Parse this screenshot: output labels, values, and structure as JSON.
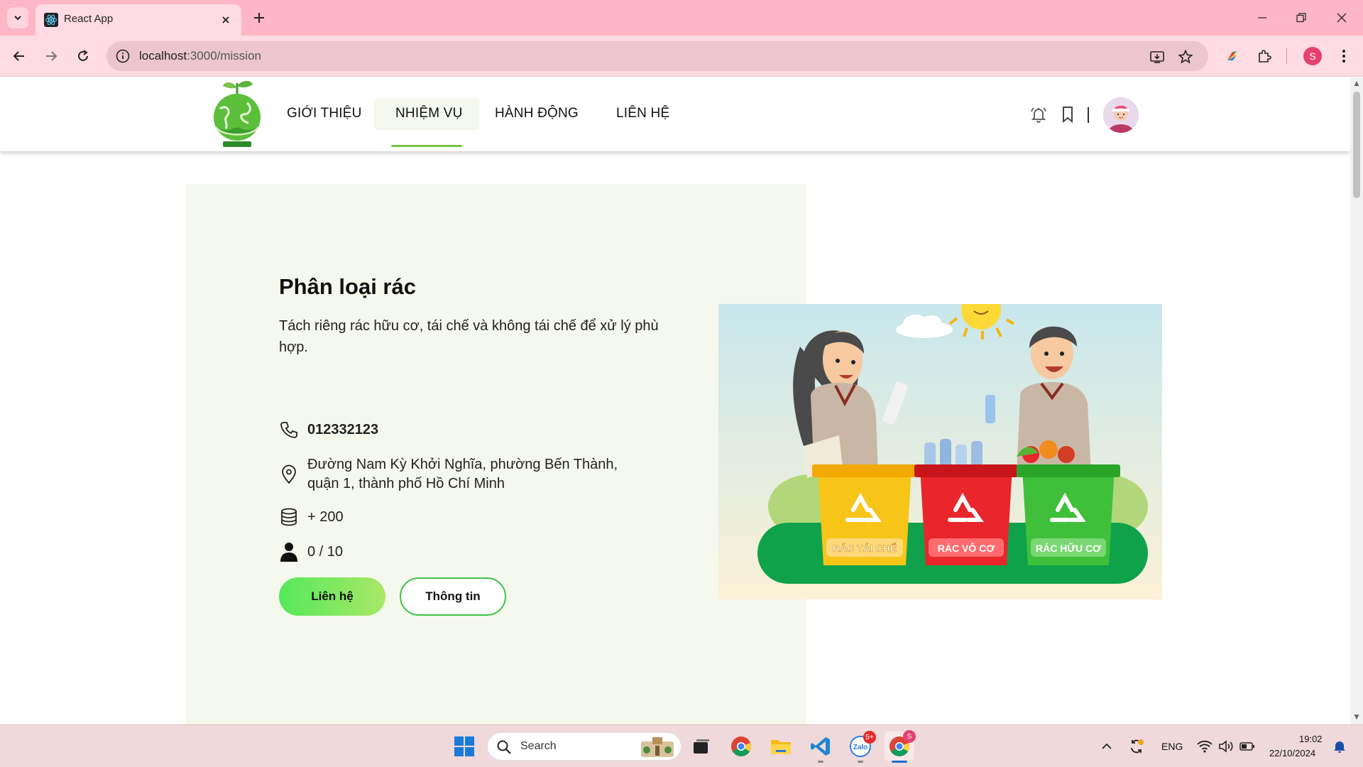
{
  "browser": {
    "tab_title": "React App",
    "url_host": "localhost",
    "url_rest": ":3000/mission",
    "profile_initial": "S"
  },
  "site_nav": {
    "items": [
      {
        "label": "GIỚI THIỆU"
      },
      {
        "label": "NHIỆM VỤ",
        "active": true
      },
      {
        "label": "HÀNH ĐỘNG"
      },
      {
        "label": "LIÊN HỆ"
      }
    ],
    "accent_color": "#76c442"
  },
  "mission": {
    "title": "Phân loại rác",
    "description": "Tách riêng rác hữu cơ, tái chế và không tái chế để xử lý phù hợp.",
    "phone": "012332123",
    "address": "Đường Nam Kỳ Khởi Nghĩa, phường Bến Thành, quận 1, thành phố Hồ Chí Minh",
    "points": "+ 200",
    "participants": "0 / 10",
    "contact_button": "Liên hệ",
    "info_button": "Thông tin"
  },
  "illustration": {
    "bins": [
      {
        "label": "RÁC TÁI CHẾ",
        "color": "#f7c518"
      },
      {
        "label": "RÁC VÔ CƠ",
        "color": "#e8262b"
      },
      {
        "label": "RÁC HỮU CƠ",
        "color": "#3fbf3a"
      }
    ]
  },
  "taskbar": {
    "search_placeholder": "Search",
    "language": "ENG",
    "time": "19:02",
    "date": "22/10/2024",
    "zalo_badge": "5+",
    "chrome_badge": "S"
  }
}
